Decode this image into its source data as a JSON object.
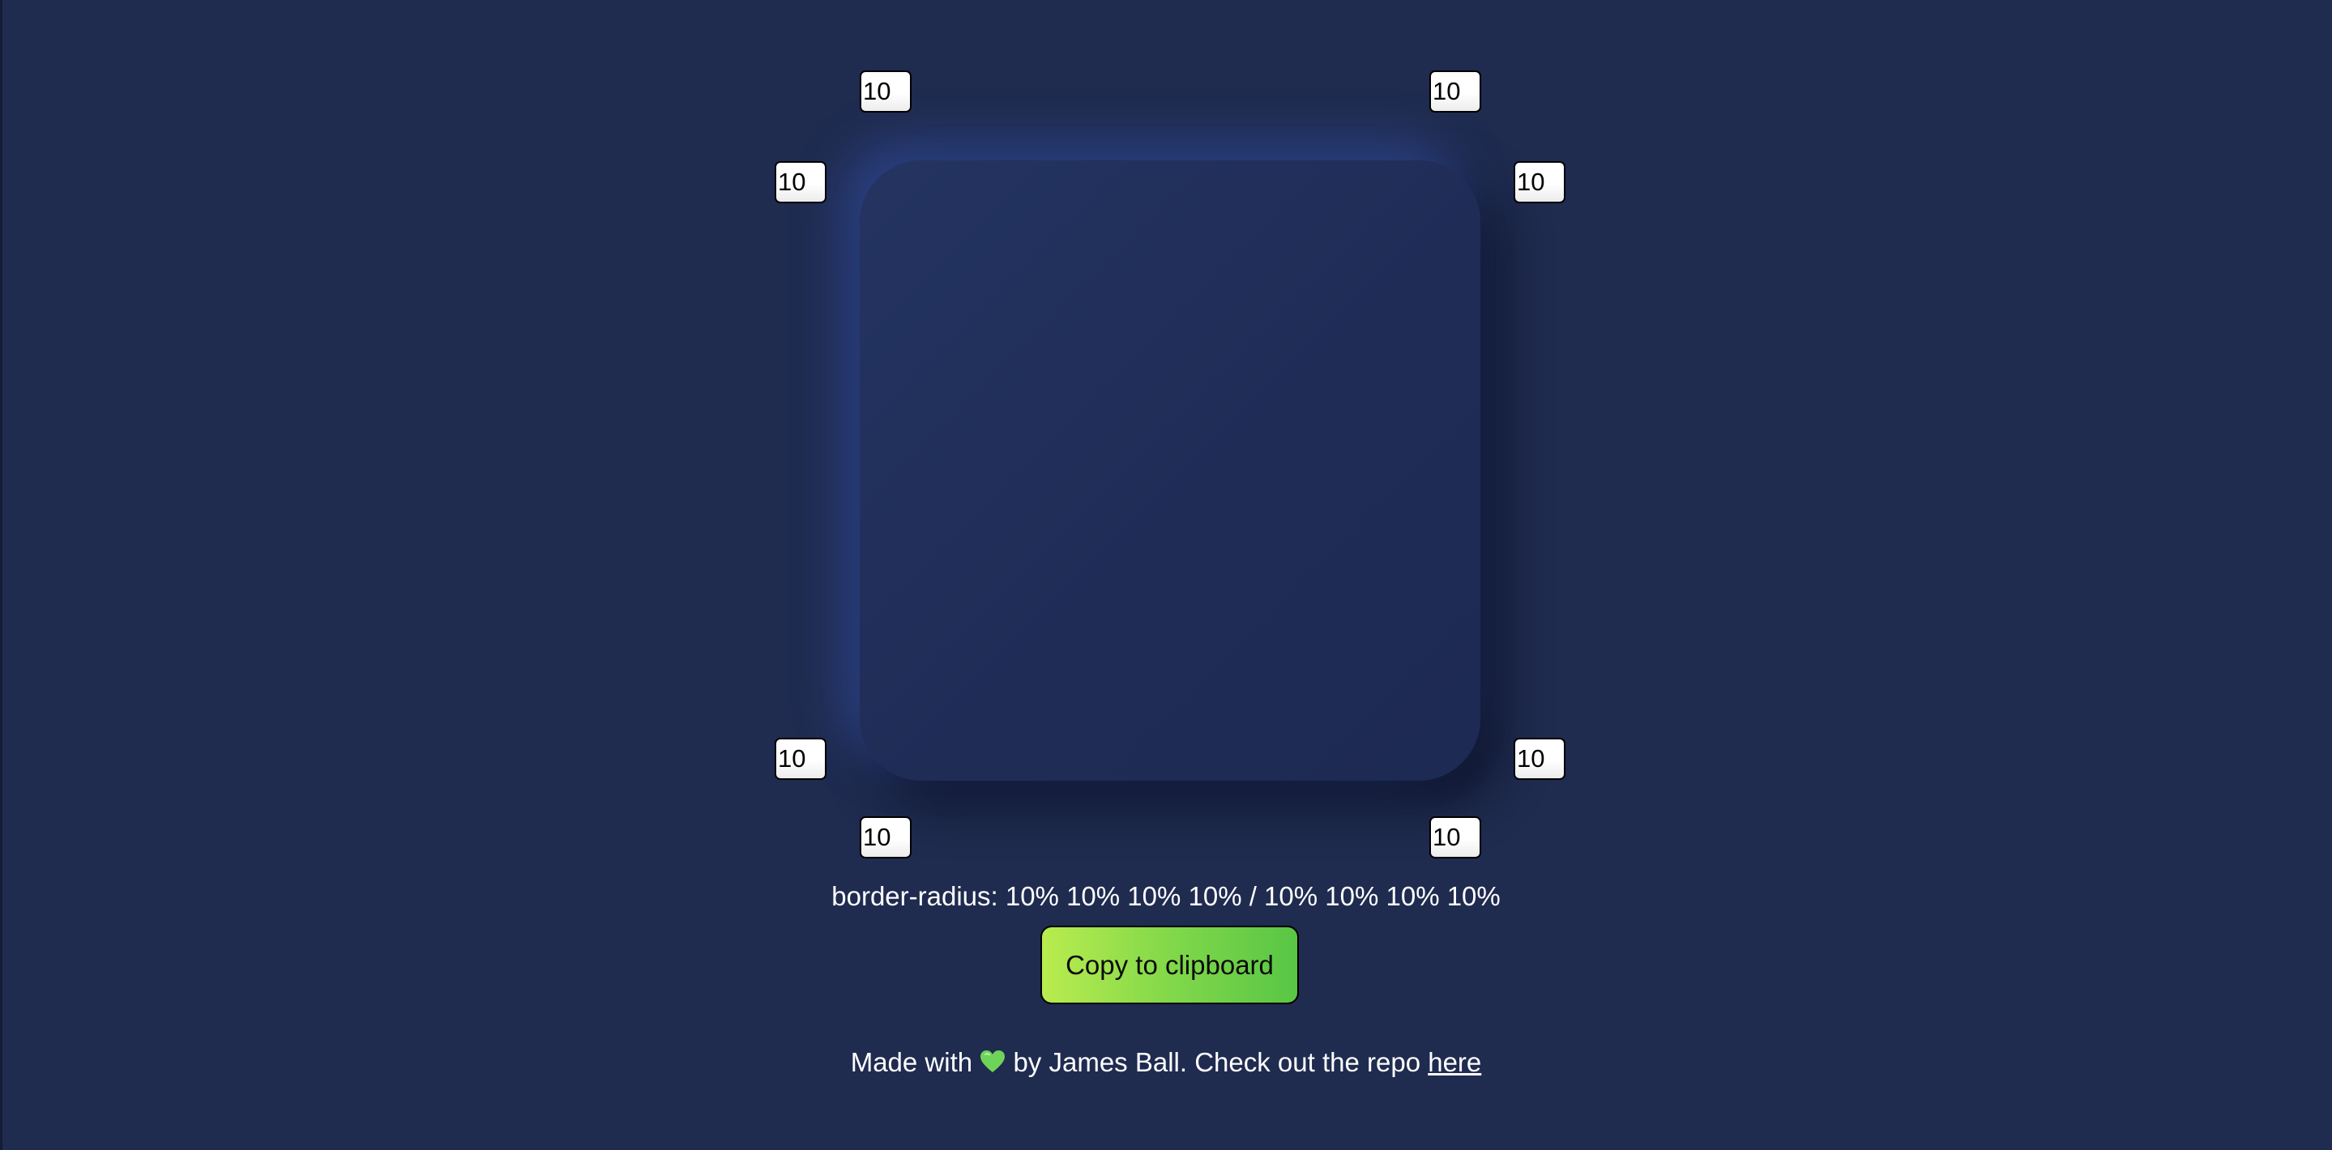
{
  "corners": {
    "top_left_horizontal": "10",
    "top_right_horizontal": "10",
    "top_left_vertical": "10",
    "top_right_vertical": "10",
    "bottom_left_vertical": "10",
    "bottom_right_vertical": "10",
    "bottom_left_horizontal": "10",
    "bottom_right_horizontal": "10"
  },
  "output_text": "border-radius: 10% 10% 10% 10% / 10% 10% 10% 10%",
  "copy_button_label": "Copy to clipboard",
  "footer": {
    "prefix": "Made with",
    "icon": "green-heart-icon",
    "middle": "by James Ball. Check out the repo",
    "link_text": "here"
  },
  "colors": {
    "background": "#1f2b4f",
    "button_gradient_start": "#b9ec4f",
    "button_gradient_end": "#58c645",
    "heart": "#6fd35a"
  }
}
